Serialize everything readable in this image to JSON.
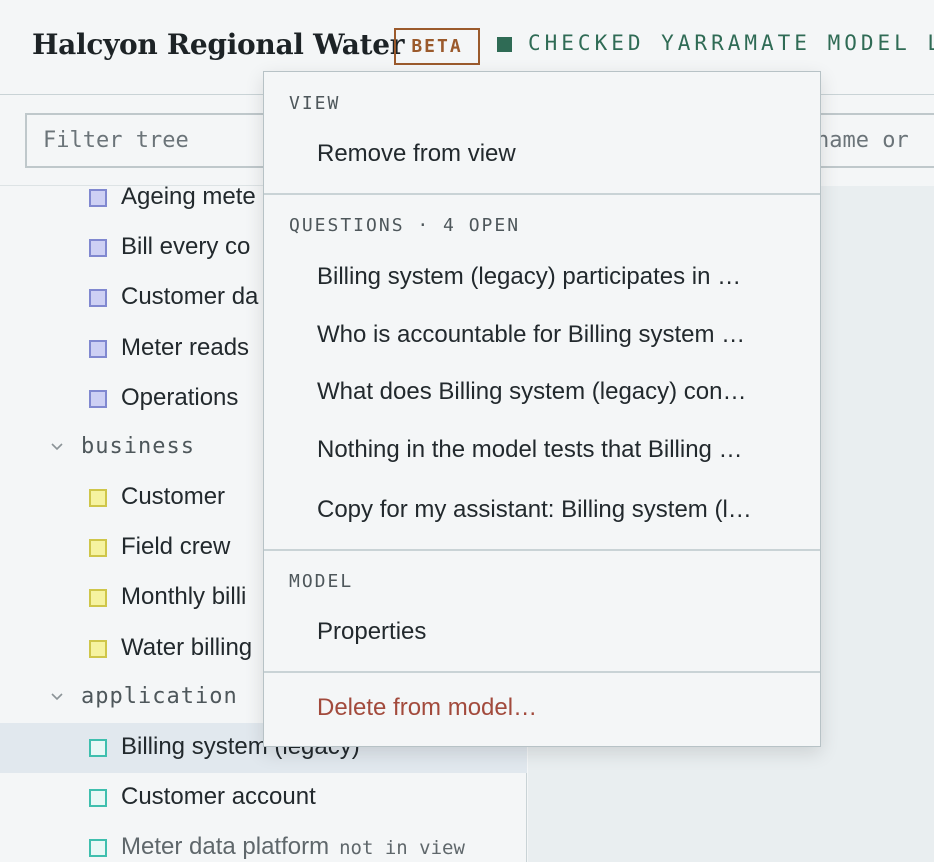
{
  "header": {
    "app_title": "Halcyon Regional Water",
    "badge": "BETA",
    "status": "CHECKED YARRAMATE MODEL L"
  },
  "left_panel": {
    "filter_placeholder": "Filter tree",
    "tree": {
      "top_items": [
        {
          "label": "Ageing mete"
        },
        {
          "label": "Bill every co"
        },
        {
          "label": "Customer da"
        },
        {
          "label": "Meter reads"
        },
        {
          "label": "Operations"
        }
      ],
      "business": {
        "label": "business",
        "items": [
          {
            "label": "Customer"
          },
          {
            "label": "Field crew"
          },
          {
            "label": "Monthly billi"
          },
          {
            "label": "Water billing"
          }
        ]
      },
      "application": {
        "label": "application",
        "items": [
          {
            "label": "Billing system (legacy)",
            "selected": true
          },
          {
            "label": "Customer account"
          },
          {
            "label": "Meter data platform",
            "note": "not in view"
          }
        ]
      }
    }
  },
  "right_panel": {
    "search_visible_text": "name or"
  },
  "context_menu": {
    "view": {
      "label": "VIEW",
      "items": [
        "Remove from view"
      ]
    },
    "questions": {
      "label": "QUESTIONS · 4 OPEN",
      "items": [
        "Billing system (legacy) participates in …",
        "Who is accountable for Billing system …",
        "What does Billing system (legacy) con…",
        "Nothing in the model tests that Billing …",
        "Copy for my assistant: Billing system (l…"
      ]
    },
    "model": {
      "label": "MODEL",
      "items": [
        "Properties"
      ]
    },
    "danger": {
      "delete_label": "Delete from model…"
    }
  },
  "colors": {
    "accent_green": "#2f6b55",
    "beta_brown": "#9b5a2c",
    "danger_red": "#a24a3c",
    "motivation_purple": "#8088d0",
    "business_yellow": "#cfc64a",
    "application_teal": "#3fbfae"
  },
  "icons": {
    "group_toggle": "chevron-down-icon",
    "status": "square-status-icon"
  }
}
